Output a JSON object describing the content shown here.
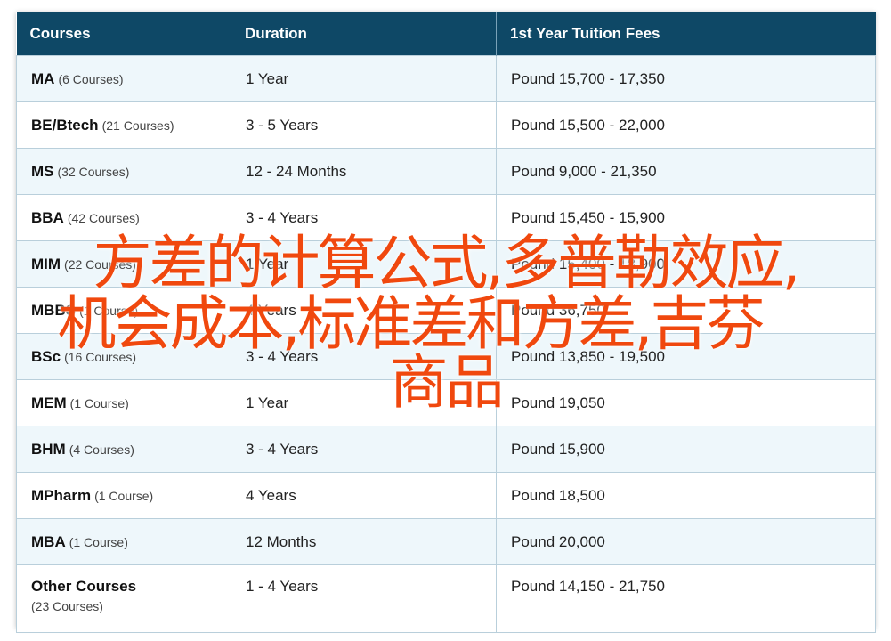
{
  "table": {
    "headers": [
      "Courses",
      "Duration",
      "1st Year Tuition Fees"
    ],
    "rows": [
      {
        "course": "MA",
        "count": "(6 Courses)",
        "duration": "1 Year",
        "fee": "Pound 15,700 - 17,350"
      },
      {
        "course": "BE/Btech",
        "count": "(21 Courses)",
        "duration": "3 - 5 Years",
        "fee": "Pound 15,500 - 22,000"
      },
      {
        "course": "MS",
        "count": "(32 Courses)",
        "duration": "12 - 24 Months",
        "fee": "Pound 9,000 - 21,350"
      },
      {
        "course": "BBA",
        "count": "(42 Courses)",
        "duration": "3 - 4 Years",
        "fee": "Pound 15,450 - 15,900"
      },
      {
        "course": "MIM",
        "count": "(22 Courses)",
        "duration": "1 Year",
        "fee": "Pound 15,400 - 18,900"
      },
      {
        "course": "MBBS",
        "count": "(1 Course)",
        "duration": "4 Years",
        "fee": "Pound 36,750"
      },
      {
        "course": "BSc",
        "count": "(16 Courses)",
        "duration": "3 - 4 Years",
        "fee": "Pound 13,850 - 19,500"
      },
      {
        "course": "MEM",
        "count": "(1 Course)",
        "duration": "1 Year",
        "fee": "Pound 19,050"
      },
      {
        "course": "BHM",
        "count": "(4 Courses)",
        "duration": "3 - 4 Years",
        "fee": "Pound 15,900"
      },
      {
        "course": "MPharm",
        "count": "(1 Course)",
        "duration": "4 Years",
        "fee": "Pound 18,500"
      },
      {
        "course": "MBA",
        "count": "(1 Course)",
        "duration": "12 Months",
        "fee": "Pound 20,000"
      },
      {
        "course": "Other Courses",
        "count": "(23 Courses)",
        "duration": "1 - 4 Years",
        "fee": "Pound 14,150 - 21,750"
      }
    ]
  },
  "overlay": {
    "line1": "方差的计算公式,多普勒效应,",
    "line2": "机会成本,标准差和方差,吉芬",
    "line3": "商品"
  },
  "colors": {
    "header_bg": "#0e4866",
    "stripe_bg": "#eef7fb",
    "overlay_text": "#f0480e"
  }
}
